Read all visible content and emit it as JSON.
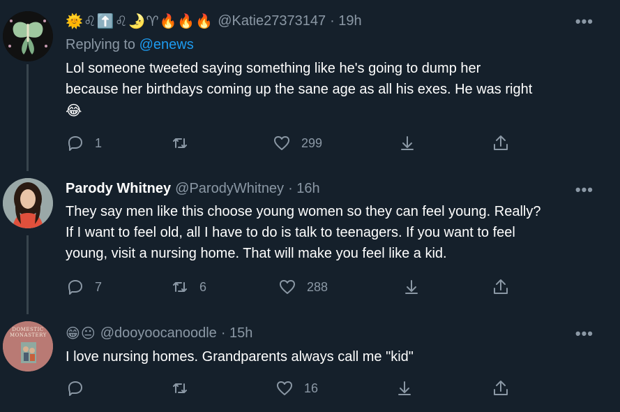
{
  "tweets": [
    {
      "header_emojis": "🌞♌⬆️♌🌛♈🔥🔥🔥",
      "handle": "@Katie27373147",
      "time": "· 19h",
      "replying_prefix": "Replying to",
      "replying_to": "@enews",
      "text_line1": "Lol someone tweeted saying something like  he's going to dump her",
      "text_line2": "because her birthdays coming up  the sane age as all his exes. He was right",
      "text_line3": "😂",
      "replies": "1",
      "retweets": "",
      "likes": "299"
    },
    {
      "name": "Parody Whitney",
      "handle": "@ParodyWhitney",
      "time": "· 16h",
      "text_line1": "They say men like this choose young women so they can feel young. Really?",
      "text_line2": "If I want to feel old, all I have to do is talk to teenagers. If you want to feel",
      "text_line3": "young, visit a nursing home. That will make you feel like a kid.",
      "replies": "7",
      "retweets": "6",
      "likes": "288"
    },
    {
      "header_emojis": "😁😐",
      "handle": "@dooyoocanoodle",
      "time": "· 15h",
      "avatar_text": "DOMESTIC MONASTERY",
      "text_line1": "I love nursing homes. Grandparents always call me \"kid\"",
      "replies": "",
      "retweets": "",
      "likes": "16"
    }
  ],
  "more_label": "•••",
  "icons": [
    "reply-icon",
    "retweet-icon",
    "like-icon",
    "bookmark-icon",
    "share-icon"
  ],
  "colors": {
    "background": "#15202b",
    "secondary_text": "#8b98a5",
    "link": "#1d9bf0"
  }
}
